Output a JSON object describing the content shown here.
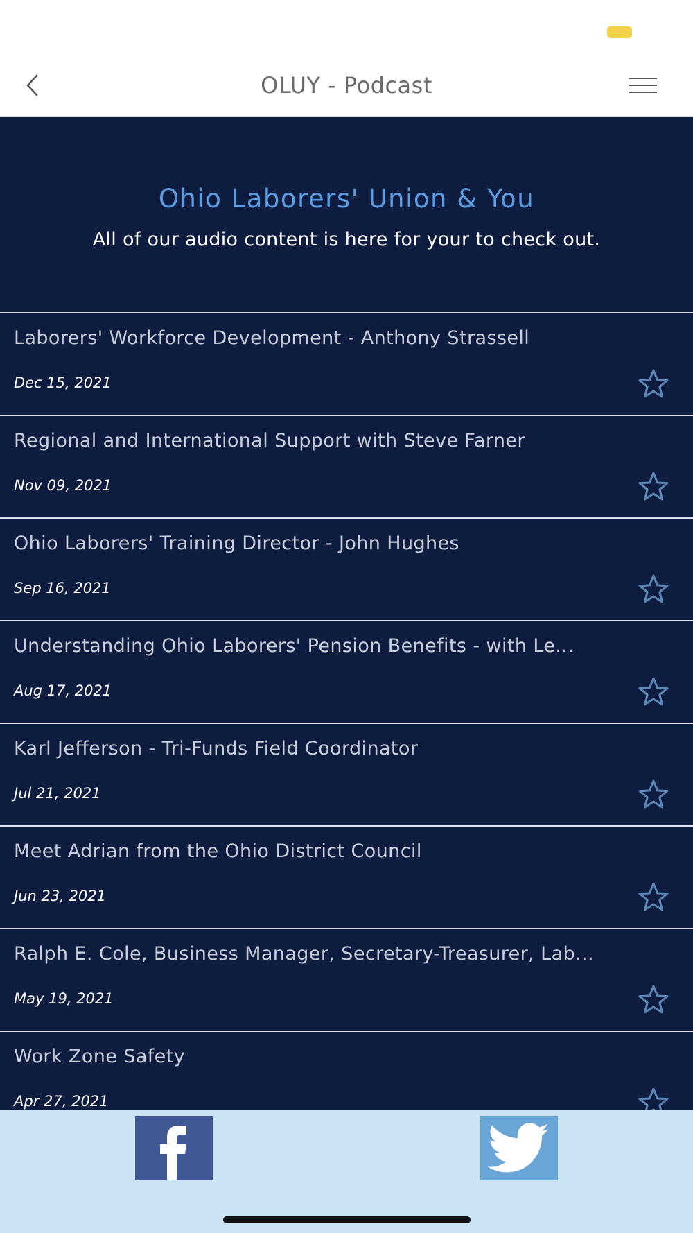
{
  "header": {
    "title": "OLUY - Podcast",
    "back_icon": "chevron-left-icon",
    "menu_icon": "hamburger-menu-icon"
  },
  "hero": {
    "title": "Ohio Laborers' Union & You",
    "subtitle": "All of our audio content is here for your to check out."
  },
  "episodes": [
    {
      "title": "Laborers' Workforce Development - Anthony Strassell",
      "date": "Dec 15, 2021"
    },
    {
      "title": "Regional and International Support with Steve Farner",
      "date": "Nov 09, 2021"
    },
    {
      "title": "Ohio Laborers' Training Director - John Hughes",
      "date": "Sep 16, 2021"
    },
    {
      "title": "Understanding Ohio Laborers' Pension Benefits - with Le...",
      "date": "Aug 17, 2021"
    },
    {
      "title": "Karl Jefferson - Tri-Funds Field Coordinator",
      "date": "Jul 21, 2021"
    },
    {
      "title": "Meet Adrian from the Ohio District Council",
      "date": "Jun 23, 2021"
    },
    {
      "title": "Ralph E. Cole, Business Manager, Secretary-Treasurer, Lab...",
      "date": "May 19, 2021"
    },
    {
      "title": "Work Zone Safety",
      "date": "Apr 27, 2021"
    }
  ],
  "footer": {
    "facebook_icon": "facebook-icon",
    "twitter_icon": "twitter-icon"
  },
  "colors": {
    "background": "#0e1c3f",
    "accent": "#5b9be0",
    "star": "#5d88b6",
    "footer": "#cae4f4",
    "facebook": "#415896",
    "twitter": "#6aa5d8"
  }
}
